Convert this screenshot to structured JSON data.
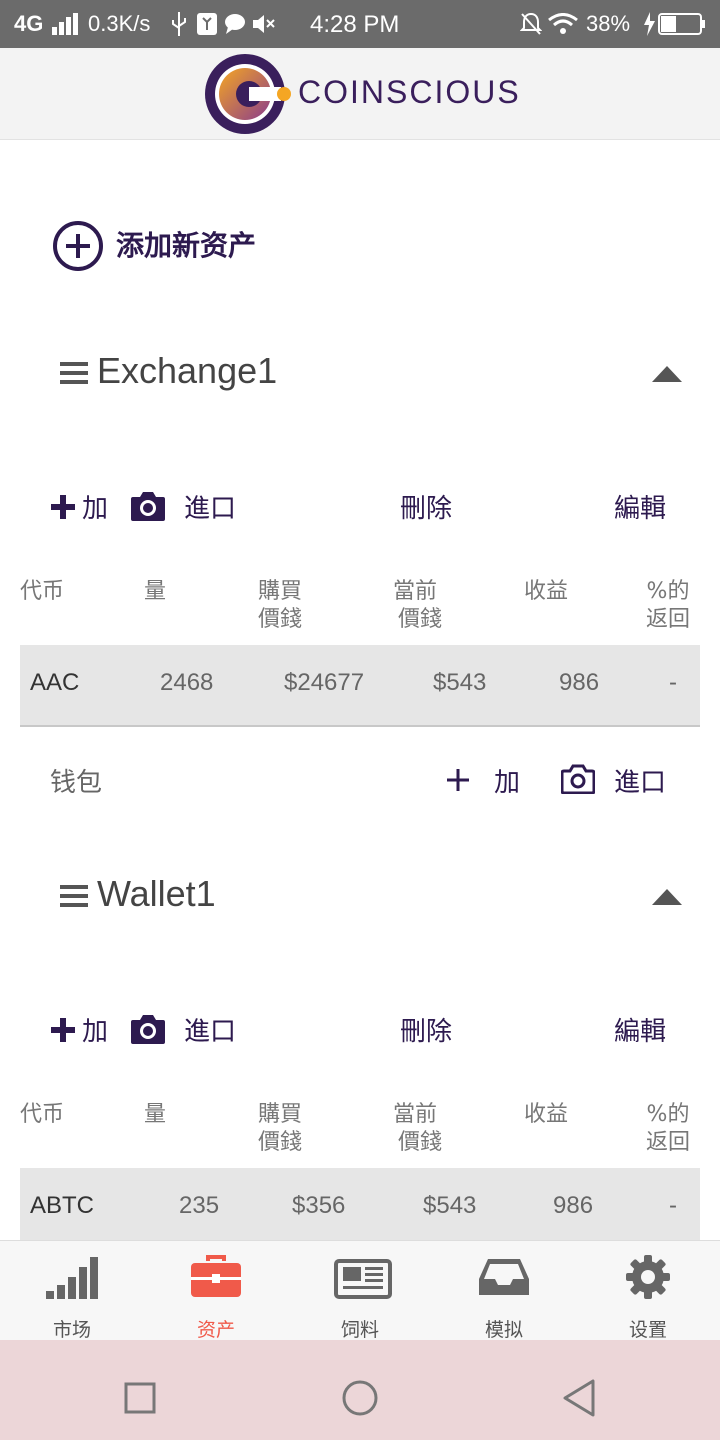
{
  "status_bar": {
    "network": "4G",
    "speed": "0.3K/s",
    "time": "4:28 PM",
    "battery": "38%"
  },
  "header": {
    "brand": "COINSCIOUS"
  },
  "add_asset": {
    "label": "添加新资产"
  },
  "sections": [
    {
      "title": "Exchange1",
      "actions": {
        "add": "加",
        "import": "進口",
        "delete": "刪除",
        "edit": "編輯"
      },
      "columns": [
        [
          "代币"
        ],
        [
          "量"
        ],
        [
          "購買",
          "價錢"
        ],
        [
          "當前",
          "價錢"
        ],
        [
          "收益"
        ],
        [
          "%的",
          "返回"
        ]
      ],
      "rows": [
        {
          "token": "AAC",
          "amount": "2468",
          "buy_price": "$24677",
          "current_price": "$543",
          "profit": "986",
          "return_pct": "-"
        }
      ]
    },
    {
      "title": "Wallet1",
      "actions": {
        "add": "加",
        "import": "進口",
        "delete": "刪除",
        "edit": "編輯"
      },
      "columns": [
        [
          "代币"
        ],
        [
          "量"
        ],
        [
          "購買",
          "價錢"
        ],
        [
          "當前",
          "價錢"
        ],
        [
          "收益"
        ],
        [
          "%的",
          "返回"
        ]
      ],
      "rows": [
        {
          "token": "ABTC",
          "amount": "235",
          "buy_price": "$356",
          "current_price": "$543",
          "profit": "986",
          "return_pct": "-"
        }
      ]
    }
  ],
  "wallet_bar": {
    "label": "钱包",
    "add": "加",
    "import": "進口"
  },
  "bottom_nav": {
    "items": [
      {
        "label": "市场",
        "icon": "signal-bars-icon",
        "active": false
      },
      {
        "label": "资产",
        "icon": "briefcase-icon",
        "active": true
      },
      {
        "label": "饲料",
        "icon": "newspaper-icon",
        "active": false
      },
      {
        "label": "模拟",
        "icon": "inbox-tray-icon",
        "active": false
      },
      {
        "label": "设置",
        "icon": "gear-icon",
        "active": false
      }
    ]
  },
  "colors": {
    "brand": "#2d1a4f",
    "active_tab": "#f05a4a",
    "row_bg": "#e6e6e6",
    "status_bar": "#6b6b6b",
    "system_nav": "#ecd6d8"
  }
}
